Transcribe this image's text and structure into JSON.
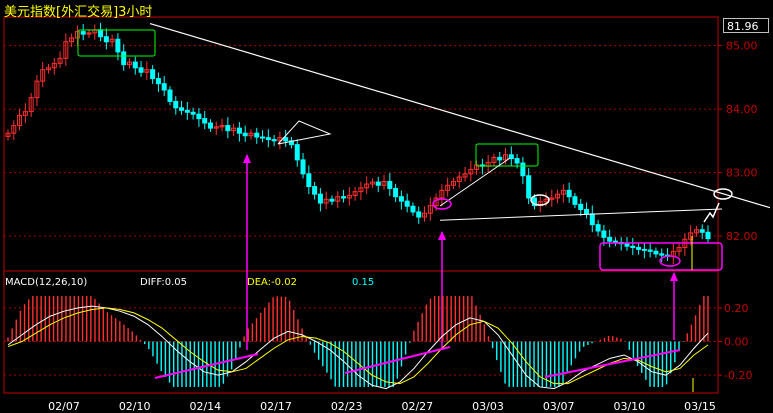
{
  "title": "美元指数[外汇交易]3小时",
  "last_price": "81.96",
  "macd": {
    "name": "MACD(12,26,10)",
    "diff": "DIFF:0.05",
    "dea": "DEA:-0.02",
    "macd_value": "0.15"
  },
  "colors": {
    "up": "#ff3030",
    "down": "#00ffff",
    "diff_line": "#ffffff",
    "dea_line": "#ffff00",
    "annotation_magenta": "#ff00ff",
    "annotation_green": "#00ff00",
    "grid": "#a00000",
    "axis": "#c00000"
  },
  "chart_data": [
    {
      "type": "candlestick",
      "title": "美元指数[外汇交易]3小时",
      "x_ticks": [
        "02/07",
        "02/10",
        "02/14",
        "02/17",
        "02/23",
        "02/27",
        "03/03",
        "03/07",
        "03/10",
        "03/15"
      ],
      "y_ticks": [
        "85.00",
        "84.00",
        "83.00",
        "82.00"
      ],
      "ylim": [
        81.45,
        85.45
      ],
      "last_value": 81.96,
      "close_series": [
        83.62,
        83.74,
        83.9,
        83.96,
        84.18,
        84.44,
        84.62,
        84.65,
        84.72,
        84.8,
        85.06,
        85.12,
        85.22,
        85.18,
        85.2,
        85.25,
        85.14,
        85.06,
        85.1,
        84.9,
        84.7,
        84.74,
        84.65,
        84.58,
        84.62,
        84.48,
        84.4,
        84.3,
        84.12,
        84.02,
        83.98,
        83.95,
        83.92,
        83.85,
        83.78,
        83.7,
        83.72,
        83.74,
        83.66,
        83.7,
        83.62,
        83.58,
        83.62,
        83.56,
        83.55,
        83.52,
        83.5,
        83.55,
        83.5,
        83.44,
        83.2,
        82.98,
        82.78,
        82.66,
        82.52,
        82.58,
        82.55,
        82.62,
        82.6,
        82.64,
        82.7,
        82.76,
        82.82,
        82.85,
        82.8,
        82.86,
        82.75,
        82.62,
        82.55,
        82.47,
        82.38,
        82.3,
        82.36,
        82.48,
        82.6,
        82.72,
        82.8,
        82.86,
        82.93,
        82.98,
        83.05,
        83.12,
        83.1,
        83.16,
        83.24,
        83.2,
        83.28,
        83.22,
        83.15,
        82.95,
        82.6,
        82.48,
        82.54,
        82.58,
        82.6,
        82.66,
        82.72,
        82.62,
        82.5,
        82.42,
        82.35,
        82.18,
        82.08,
        81.98,
        81.92,
        81.9,
        81.88,
        81.84,
        81.82,
        81.79,
        81.78,
        81.76,
        81.72,
        81.7,
        81.68,
        81.76,
        81.82,
        81.95,
        82.05,
        82.1,
        82.06,
        81.96
      ],
      "annotation_values": {
        "resistance_line": [
          85.22,
          82.4
        ],
        "support_line": [
          82.25,
          82.38
        ],
        "marked_rectangle_range": [
          81.68,
          82.05
        ]
      }
    },
    {
      "type": "macd",
      "name": "MACD(12,26,10)",
      "diff": 0.05,
      "dea": -0.02,
      "macd": 0.15,
      "y_ticks": [
        "0.20",
        "0.00",
        "-0.20"
      ],
      "ylim": [
        -0.3,
        0.3
      ],
      "diff_series": [
        -0.02,
        0.04,
        0.1,
        0.15,
        0.18,
        0.2,
        0.21,
        0.2,
        0.18,
        0.15,
        0.1,
        0.03,
        -0.05,
        -0.12,
        -0.18,
        -0.2,
        -0.18,
        -0.12,
        -0.05,
        0.02,
        0.06,
        0.04,
        0.0,
        -0.05,
        -0.12,
        -0.2,
        -0.26,
        -0.28,
        -0.24,
        -0.16,
        -0.06,
        0.03,
        0.1,
        0.14,
        0.12,
        0.04,
        -0.08,
        -0.2,
        -0.27,
        -0.28,
        -0.24,
        -0.18,
        -0.14,
        -0.1,
        -0.08,
        -0.12,
        -0.18,
        -0.2,
        -0.14,
        -0.04,
        0.05
      ],
      "dea_series": [
        -0.03,
        0.0,
        0.05,
        0.1,
        0.14,
        0.17,
        0.19,
        0.2,
        0.19,
        0.17,
        0.13,
        0.08,
        0.01,
        -0.06,
        -0.12,
        -0.17,
        -0.18,
        -0.16,
        -0.1,
        -0.04,
        0.01,
        0.03,
        0.02,
        -0.01,
        -0.06,
        -0.13,
        -0.2,
        -0.24,
        -0.25,
        -0.21,
        -0.13,
        -0.04,
        0.04,
        0.1,
        0.12,
        0.08,
        -0.01,
        -0.12,
        -0.21,
        -0.25,
        -0.25,
        -0.21,
        -0.17,
        -0.13,
        -0.1,
        -0.11,
        -0.15,
        -0.18,
        -0.16,
        -0.08,
        -0.02
      ]
    }
  ]
}
